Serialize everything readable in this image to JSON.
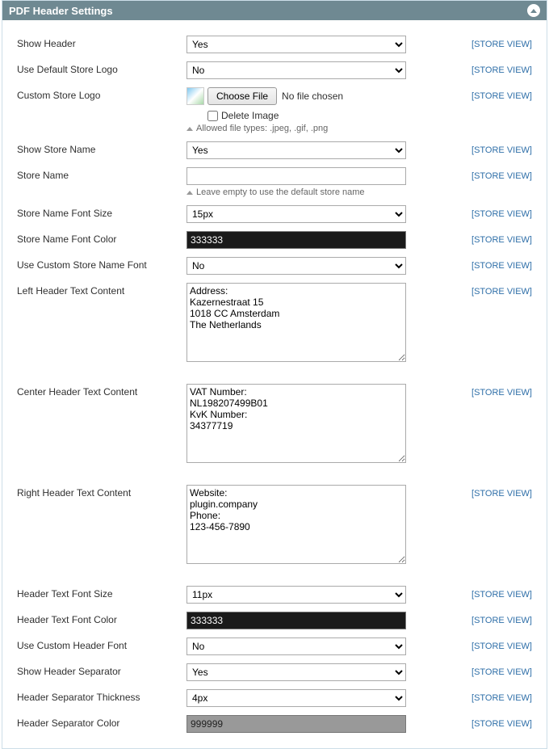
{
  "panel_title": "PDF Header Settings",
  "labels": {
    "show_header": "Show Header",
    "use_default_logo": "Use Default Store Logo",
    "custom_logo": "Custom Store Logo",
    "choose_file_btn": "Choose File",
    "no_file_chosen": "No file chosen",
    "delete_image": "Delete Image",
    "allowed_types": "Allowed file types: .jpeg, .gif, .png",
    "show_store_name": "Show Store Name",
    "store_name": "Store Name",
    "store_name_note": "Leave empty to use the default store name",
    "store_name_font_size": "Store Name Font Size",
    "store_name_font_color": "Store Name Font Color",
    "use_custom_store_name_font": "Use Custom Store Name Font",
    "left_header": "Left Header Text Content",
    "center_header": "Center Header Text Content",
    "right_header": "Right Header Text Content",
    "header_text_font_size": "Header Text Font Size",
    "header_text_font_color": "Header Text Font Color",
    "use_custom_header_font": "Use Custom Header Font",
    "show_header_separator": "Show Header Separator",
    "header_separator_thickness": "Header Separator Thickness",
    "header_separator_color": "Header Separator Color"
  },
  "values": {
    "show_header": "Yes",
    "use_default_logo": "No",
    "show_store_name": "Yes",
    "store_name": "",
    "store_name_font_size": "15px",
    "store_name_font_color": "333333",
    "use_custom_store_name_font": "No",
    "left_header": "Address:\nKazernestraat 15\n1018 CC Amsterdam\nThe Netherlands",
    "center_header": "VAT Number:\nNL198207499B01\nKvK Number:\n34377719",
    "right_header": "Website:\nplugin.company\nPhone:\n123-456-7890",
    "header_text_font_size": "11px",
    "header_text_font_color": "333333",
    "use_custom_header_font": "No",
    "show_header_separator": "Yes",
    "header_separator_thickness": "4px",
    "header_separator_color": "999999"
  },
  "colors": {
    "store_name_font_color_bg": "#1a1a1a",
    "header_text_font_color_bg": "#1a1a1a",
    "header_separator_color_bg": "#999999"
  },
  "scope_label": "[STORE VIEW]"
}
